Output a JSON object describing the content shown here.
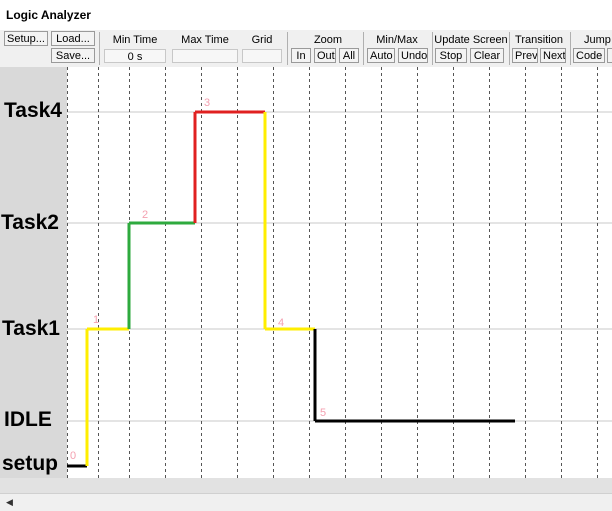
{
  "window": {
    "title": "Logic Analyzer"
  },
  "toolbar": {
    "setup_label": "Setup...",
    "load_label": "Load...",
    "save_label": "Save...",
    "min_time_label": "Min Time",
    "min_time_value": "0 s",
    "max_time_label": "Max Time",
    "max_time_value": "",
    "grid_label": "Grid",
    "grid_value": "",
    "zoom_label": "Zoom",
    "zoom_in": "In",
    "zoom_out": "Out",
    "zoom_all": "All",
    "minmax_label": "Min/Max",
    "minmax_auto": "Auto",
    "minmax_undo": "Undo",
    "update_label": "Update Screen",
    "update_stop": "Stop",
    "update_clear": "Clear",
    "transition_label": "Transition",
    "transition_prev": "Prev",
    "transition_next": "Next",
    "jump_label": "Jump",
    "jump_code": "Code"
  },
  "signals": [
    {
      "name": "Task4"
    },
    {
      "name": "Task2"
    },
    {
      "name": "Task1"
    },
    {
      "name": "IDLE"
    },
    {
      "name": "setup"
    }
  ],
  "colors": {
    "setup": "#000000",
    "task1": "#ffee00",
    "task2": "#2eaa3e",
    "task4": "#e02020",
    "idle": "#000000",
    "point_label": "#f4a0b0"
  },
  "trace": {
    "level_order": [
      "setup",
      "IDLE",
      "Task1",
      "Task2",
      "Task4"
    ],
    "points": [
      {
        "label": "0",
        "level": "setup",
        "to": "Task1",
        "color_key": "task1"
      },
      {
        "label": "1",
        "level": "Task1",
        "to": "Task2",
        "color_key": "task2"
      },
      {
        "label": "2",
        "level": "Task2",
        "to": "Task4",
        "color_key": "task4"
      },
      {
        "label": "3",
        "level": "Task4",
        "to": "Task1",
        "color_key": "task1"
      },
      {
        "label": "4",
        "level": "Task1",
        "to": "IDLE",
        "color_key": "idle"
      },
      {
        "label": "5",
        "level": "IDLE",
        "to": "",
        "color_key": "idle"
      }
    ]
  }
}
